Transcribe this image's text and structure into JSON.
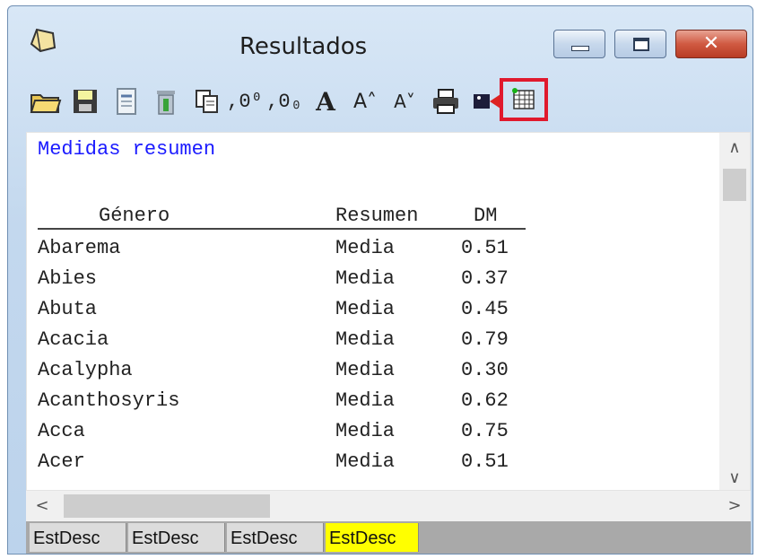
{
  "window": {
    "title": "Resultados"
  },
  "toolbar": {
    "buttons": [
      {
        "icon": "open-folder-icon"
      },
      {
        "icon": "save-floppy-icon"
      },
      {
        "icon": "document-icon"
      },
      {
        "icon": "trash-icon"
      },
      {
        "icon": "copy-icon"
      },
      {
        "icon": "increase-decimals-icon",
        "glyph": ",0⁰"
      },
      {
        "icon": "decrease-decimals-icon",
        "glyph": ",0₀"
      },
      {
        "icon": "font-bold-icon",
        "glyph": "A"
      },
      {
        "icon": "font-larger-icon",
        "glyph": "A˄"
      },
      {
        "icon": "font-smaller-icon",
        "glyph": "A˅"
      },
      {
        "icon": "printer-icon"
      },
      {
        "icon": "export-icon"
      },
      {
        "icon": "table-grid-icon",
        "selected": true
      }
    ]
  },
  "output": {
    "heading": "Medidas resumen",
    "columns": [
      "Género",
      "Resumen",
      "DM"
    ],
    "rows": [
      [
        "Abarema",
        "Media",
        "0.51"
      ],
      [
        "Abies",
        "Media",
        "0.37"
      ],
      [
        "Abuta",
        "Media",
        "0.45"
      ],
      [
        "Acacia",
        "Media",
        "0.79"
      ],
      [
        "Acalypha",
        "Media",
        "0.30"
      ],
      [
        "Acanthosyris",
        "Media",
        "0.62"
      ],
      [
        "Acca",
        "Media",
        "0.75"
      ],
      [
        "Acer",
        "Media",
        "0.51"
      ]
    ]
  },
  "tabs": [
    {
      "label": "EstDesc",
      "selected": false
    },
    {
      "label": "EstDesc",
      "selected": false
    },
    {
      "label": "EstDesc",
      "selected": false
    },
    {
      "label": "EstDesc",
      "selected": true
    }
  ],
  "colors": {
    "heading": "#1a1aff",
    "selected_tab": "#ffff00",
    "highlight_border": "#e0192d"
  }
}
